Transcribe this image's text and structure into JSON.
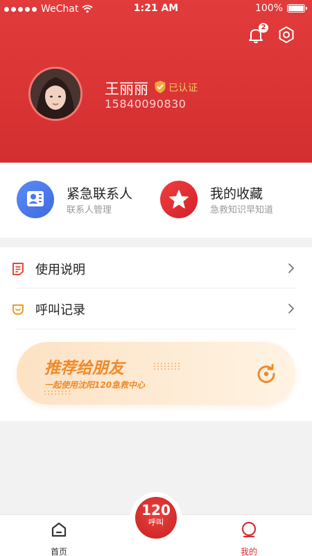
{
  "status_bar": {
    "carrier": "WeChat",
    "time": "1:21 AM",
    "battery": "100%"
  },
  "header": {
    "notification_count": "2",
    "user": {
      "name": "王丽丽",
      "verified_label": "已认证",
      "phone": "15840090830"
    }
  },
  "shortcuts": [
    {
      "title": "紧急联系人",
      "subtitle": "联系人管理",
      "icon": "contact-card-icon",
      "color": "#4a76ea"
    },
    {
      "title": "我的收藏",
      "subtitle": "急救知识早知道",
      "icon": "star-icon",
      "color": "#e52a2e"
    }
  ],
  "menu": {
    "items": [
      {
        "label": "使用说明",
        "icon": "document-icon"
      },
      {
        "label": "呼叫记录",
        "icon": "call-record-icon"
      }
    ]
  },
  "banner": {
    "title": "推荐给朋友",
    "subtitle": "一起使用沈阳120急救中心",
    "icon": "share-refresh-icon"
  },
  "tabbar": {
    "home_label": "首页",
    "call": {
      "number": "120",
      "label": "呼叫"
    },
    "mine_label": "我的",
    "active_color": "#d42f30"
  }
}
